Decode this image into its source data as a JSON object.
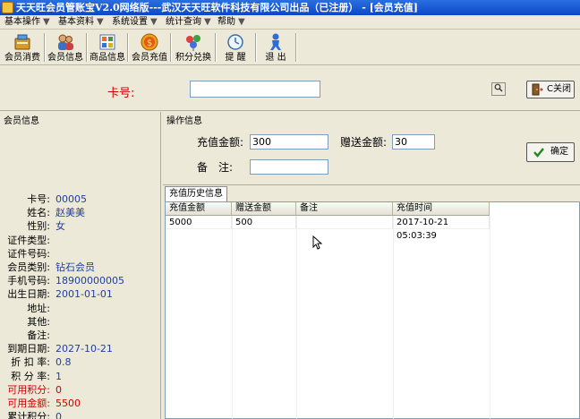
{
  "window": {
    "title": "天天旺会员管账宝V2.0网络版---武汉天天旺软件科技有限公司出品（已注册） - [会员充值]"
  },
  "menu": [
    {
      "label": "基本操作",
      "arrow": "▼"
    },
    {
      "label": "基本资料",
      "arrow": "▼"
    },
    {
      "label": "系统设置",
      "arrow": "▼"
    },
    {
      "label": "统计查询",
      "arrow": "▼"
    },
    {
      "label": "帮助",
      "arrow": "▼"
    }
  ],
  "toolbar": [
    {
      "label": "会员消费",
      "icon": "member-consume-icon"
    },
    {
      "label": "会员信息",
      "icon": "member-info-icon"
    },
    {
      "label": "商品信息",
      "icon": "product-info-icon"
    },
    {
      "label": "会员充值",
      "icon": "recharge-icon"
    },
    {
      "label": "积分兑换",
      "icon": "points-exchange-icon"
    },
    {
      "label": "提 醒",
      "icon": "reminder-icon"
    },
    {
      "label": "退 出",
      "icon": "exit-icon"
    }
  ],
  "card": {
    "label": "卡号:",
    "value": "",
    "close_label": "C关闭"
  },
  "member_info": {
    "title": "会员信息",
    "fields": [
      {
        "key": "卡号:",
        "value": "00005",
        "red": false
      },
      {
        "key": "姓名:",
        "value": "赵美美",
        "red": false
      },
      {
        "key": "性别:",
        "value": "女",
        "red": false
      },
      {
        "key": "证件类型:",
        "value": "",
        "red": false
      },
      {
        "key": "证件号码:",
        "value": "",
        "red": false
      },
      {
        "key": "会员类别:",
        "value": "钻石会员",
        "red": false
      },
      {
        "key": "手机号码:",
        "value": "18900000005",
        "red": false
      },
      {
        "key": "出生日期:",
        "value": "2001-01-01",
        "red": false
      },
      {
        "key": "地址:",
        "value": "",
        "red": false
      },
      {
        "key": "其他:",
        "value": "",
        "red": false
      },
      {
        "key": "备注:",
        "value": "",
        "red": false
      },
      {
        "key": "到期日期:",
        "value": "2027-10-21",
        "red": false
      },
      {
        "key": "折 扣 率:",
        "value": "0.8",
        "red": false
      },
      {
        "key": "积 分 率:",
        "value": "1",
        "red": false
      },
      {
        "key": "可用积分:",
        "value": "0",
        "red": true
      },
      {
        "key": "可用金额:",
        "value": "5500",
        "red": true
      },
      {
        "key": "累计积分:",
        "value": "0",
        "red": false
      }
    ]
  },
  "operation": {
    "title": "操作信息",
    "recharge_label": "充值金额:",
    "recharge_value": "300",
    "bonus_label": "赠送金额:",
    "bonus_value": "30",
    "note_label": "备　注:",
    "note_value": "",
    "confirm_label": "确定"
  },
  "history": {
    "tab_label": "充值历史信息",
    "columns": [
      "充值金额",
      "赠送金额",
      "备注",
      "充值时间"
    ],
    "rows": [
      [
        "5000",
        "500",
        "",
        "2017-10-21 05:03:39"
      ]
    ]
  }
}
